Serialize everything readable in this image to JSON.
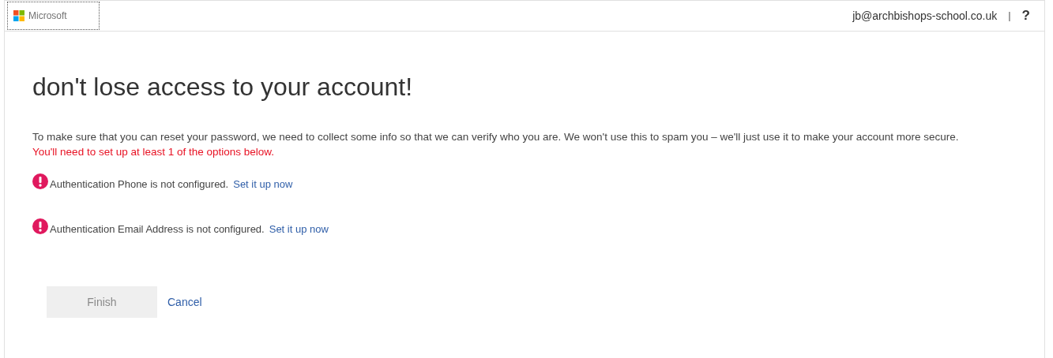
{
  "header": {
    "logo": "Microsoft",
    "user": "jb@archbishops-school.co.uk",
    "separator": "|",
    "help": "?"
  },
  "title": "don't lose access to your account!",
  "intro": {
    "text": "To make sure that you can reset your password, we need to collect some info so that we can verify who you are. We won't use this to spam you – we'll just use it to make your account more secure.",
    "warning": "You'll need to set up at least 1 of the options below."
  },
  "methods": [
    {
      "text": "Authentication Phone is not configured.",
      "link": "Set it up now",
      "configured": false
    },
    {
      "text": "Authentication Email Address is not configured.",
      "link": "Set it up now",
      "configured": false
    }
  ],
  "buttons": [
    {
      "label": "Finish",
      "kind": "button",
      "disabled": true
    },
    {
      "label": "Cancel",
      "kind": "link",
      "disabled": false
    }
  ]
}
